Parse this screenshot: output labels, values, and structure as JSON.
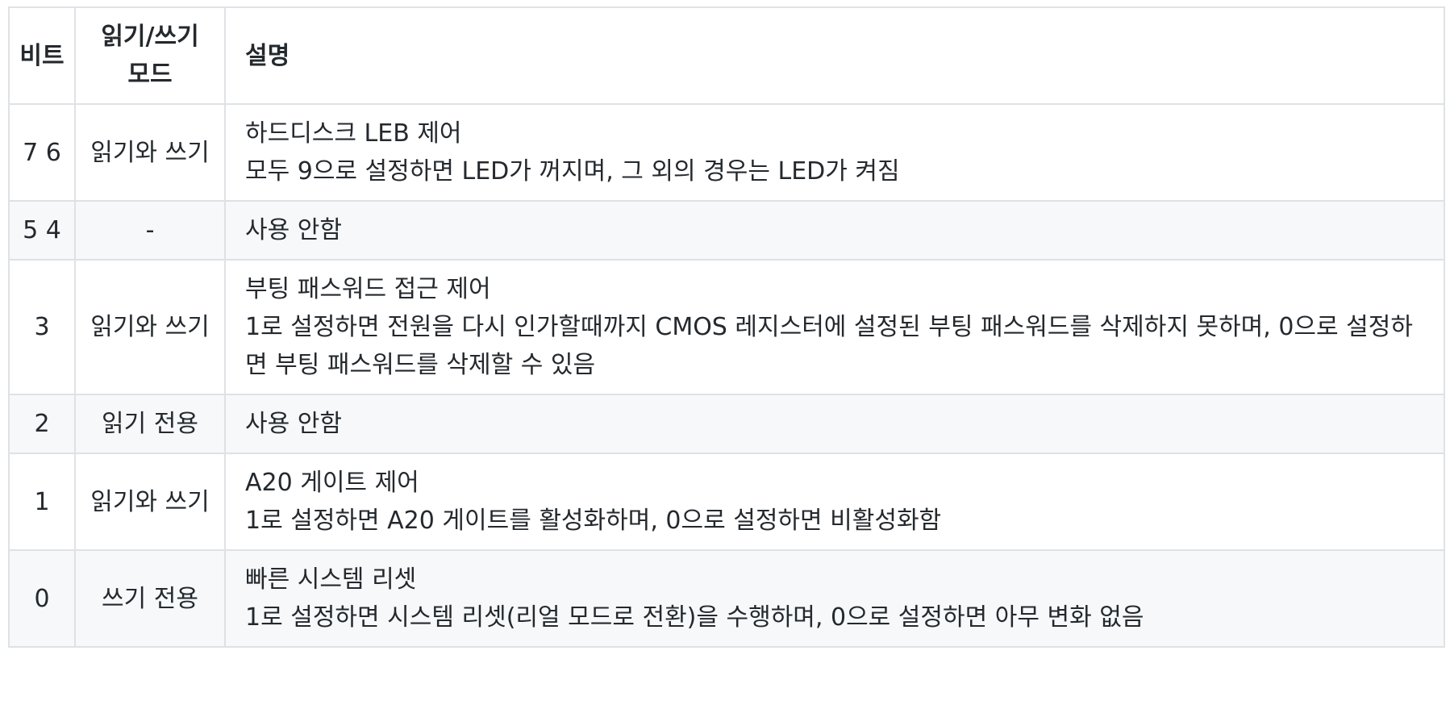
{
  "header": {
    "bit": "비트",
    "mode": "읽기/쓰기 모드",
    "desc": "설명"
  },
  "rows": [
    {
      "bit": "7 6",
      "mode": "읽기와 쓰기",
      "desc_title": "하드디스크 LEB 제어",
      "desc_detail": "모두 9으로 설정하면 LED가 꺼지며, 그 외의 경우는 LED가 켜짐"
    },
    {
      "bit": "5 4",
      "mode": "-",
      "desc_title": "사용 안함",
      "desc_detail": ""
    },
    {
      "bit": "3",
      "mode": "읽기와 쓰기",
      "desc_title": "부팅 패스워드 접근 제어",
      "desc_detail": "1로 설정하면 전원을 다시 인가할때까지 CMOS 레지스터에 설정된 부팅 패스워드를 삭제하지 못하며, 0으로 설정하면 부팅 패스워드를 삭제할 수 있음"
    },
    {
      "bit": "2",
      "mode": "읽기 전용",
      "desc_title": "사용 안함",
      "desc_detail": ""
    },
    {
      "bit": "1",
      "mode": "읽기와 쓰기",
      "desc_title": "A20 게이트 제어",
      "desc_detail": "1로 설정하면 A20 게이트를 활성화하며, 0으로 설정하면 비활성화함"
    },
    {
      "bit": "0",
      "mode": "쓰기 전용",
      "desc_title": "빠른 시스템 리셋",
      "desc_detail": "1로 설정하면 시스템 리셋(리얼 모드로 전환)을 수행하며, 0으로 설정하면 아무 변화 없음"
    }
  ]
}
